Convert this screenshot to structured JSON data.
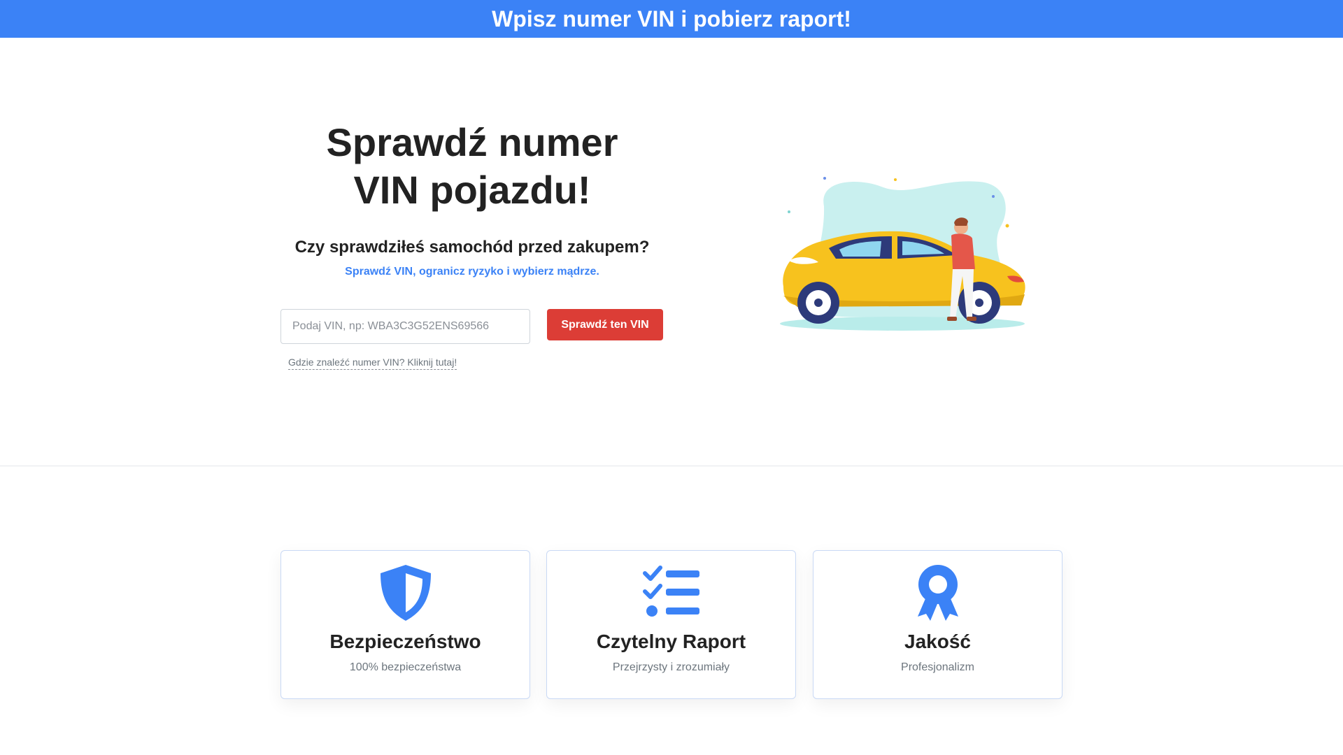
{
  "topbar": {
    "text": "Wpisz numer VIN i pobierz raport!"
  },
  "hero": {
    "title_line1": "Sprawdź numer",
    "title_line2": "VIN pojazdu!",
    "subtitle": "Czy sprawdziłeś samochód przed zakupem?",
    "tagline": "Sprawdź VIN, ogranicz ryzyko i wybierz mądrze."
  },
  "search": {
    "placeholder": "Podaj VIN, np: WBA3C3G52ENS69566",
    "value": "",
    "button_label": "Sprawdź ten VIN",
    "help_link": "Gdzie znaleźć numer VIN? Kliknij tutaj!"
  },
  "colors": {
    "accent": "#3b82f6",
    "cta": "#dc3d36",
    "car": "#f7c21e"
  },
  "features": [
    {
      "icon": "shield-icon",
      "title": "Bezpieczeństwo",
      "text": "100% bezpieczeństwa"
    },
    {
      "icon": "checklist-icon",
      "title": "Czytelny Raport",
      "text": "Przejrzysty i zrozumiały"
    },
    {
      "icon": "award-icon",
      "title": "Jakość",
      "text": "Profesjonalizm"
    }
  ]
}
